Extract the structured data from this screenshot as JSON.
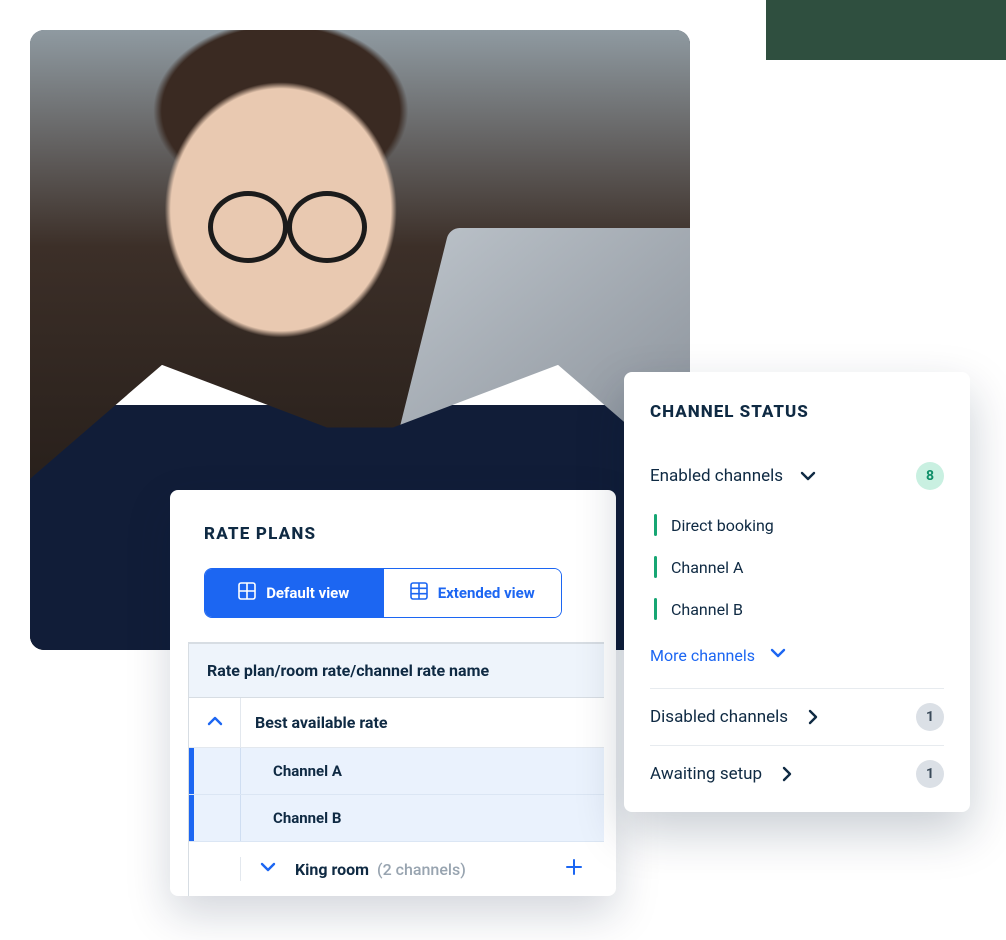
{
  "rate_plans": {
    "title": "RATE PLANS",
    "views": {
      "default": "Default view",
      "extended": "Extended view",
      "active": "default"
    },
    "table": {
      "header": "Rate plan/room rate/channel rate name",
      "rows": [
        {
          "label": "Best available rate",
          "expanded": true,
          "channels": [
            "Channel A",
            "Channel B"
          ]
        }
      ],
      "king_room": {
        "label": "King room",
        "count_text": "(2 channels)",
        "expanded": false
      }
    }
  },
  "channel_status": {
    "title": "CHANNEL STATUS",
    "enabled": {
      "label": "Enabled channels",
      "count": "8",
      "items": [
        "Direct booking",
        "Channel A",
        "Channel B"
      ],
      "more_label": "More channels"
    },
    "disabled": {
      "label": "Disabled channels",
      "count": "1"
    },
    "awaiting": {
      "label": "Awaiting setup",
      "count": "1"
    }
  }
}
